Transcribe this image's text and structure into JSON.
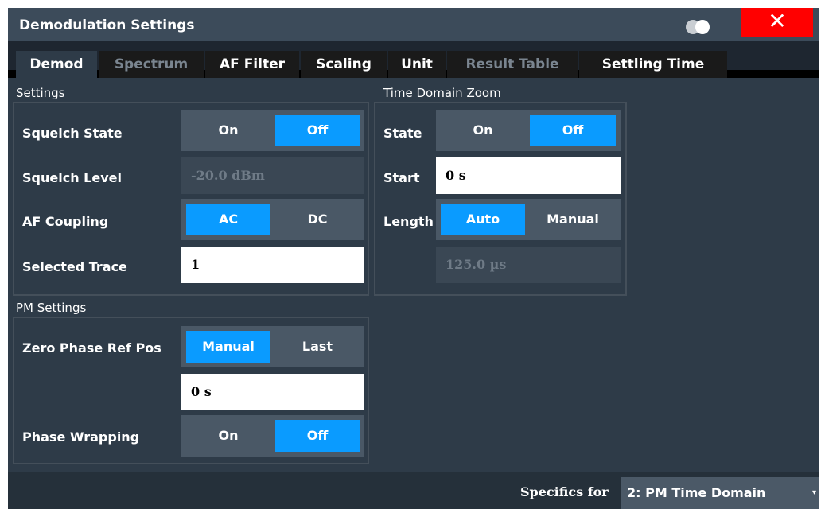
{
  "title": "Demodulation Settings",
  "close_label": "✕",
  "tabs": [
    {
      "label": "Demod"
    },
    {
      "label": "Spectrum"
    },
    {
      "label": "AF Filter"
    },
    {
      "label": "Scaling"
    },
    {
      "label": "Unit"
    },
    {
      "label": "Result Table"
    },
    {
      "label": "Settling Time"
    }
  ],
  "settings": {
    "title": "Settings",
    "squelch_state": {
      "label": "Squelch State",
      "options": [
        "On",
        "Off"
      ],
      "selected": "Off"
    },
    "squelch_level": {
      "label": "Squelch Level",
      "value": "-20.0 dBm"
    },
    "af_coupling": {
      "label": "AF Coupling",
      "options": [
        "AC",
        "DC"
      ],
      "selected": "AC"
    },
    "selected_trace": {
      "label": "Selected Trace",
      "value": "1"
    }
  },
  "time_domain_zoom": {
    "title": "Time Domain Zoom",
    "state": {
      "label": "State",
      "options": [
        "On",
        "Off"
      ],
      "selected": "Off"
    },
    "start": {
      "label": "Start",
      "value": "0 s"
    },
    "length": {
      "label": "Length",
      "options": [
        "Auto",
        "Manual"
      ],
      "selected": "Auto",
      "value": "125.0 µs"
    }
  },
  "pm_settings": {
    "title": "PM Settings",
    "zero_phase": {
      "label": "Zero Phase Ref Pos",
      "options": [
        "Manual",
        "Last"
      ],
      "selected": "Manual",
      "value": "0 s"
    },
    "phase_wrapping": {
      "label": "Phase Wrapping",
      "options": [
        "On",
        "Off"
      ],
      "selected": "Off"
    }
  },
  "footer": {
    "specifics_label": "Specifics for",
    "specifics_value": "2: PM Time Domain"
  },
  "colors": {
    "accent": "#0a9bff",
    "close": "#ff0000",
    "panel": "#2e3b48",
    "titlebar": "#3c4b5a"
  }
}
